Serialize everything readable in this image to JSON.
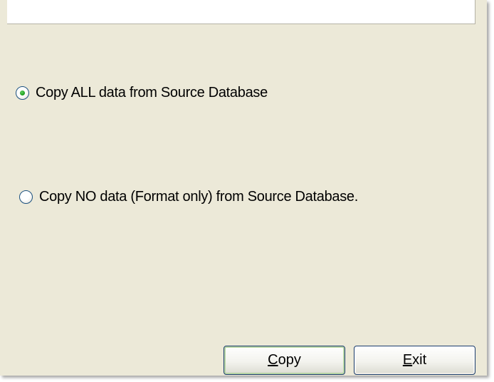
{
  "options": [
    {
      "label": "Copy ALL data from Source Database",
      "selected": true
    },
    {
      "label": "Copy NO data (Format only) from Source Database.",
      "selected": false
    }
  ],
  "buttons": {
    "copy": {
      "mnemonic": "C",
      "rest": "opy"
    },
    "exit": {
      "mnemonic": "E",
      "rest": "xit"
    }
  },
  "colors": {
    "dialog_bg": "#ece9d8",
    "radio_dot": "#21a121",
    "radio_border": "#1c5180",
    "button_border": "#1b3d6d"
  }
}
